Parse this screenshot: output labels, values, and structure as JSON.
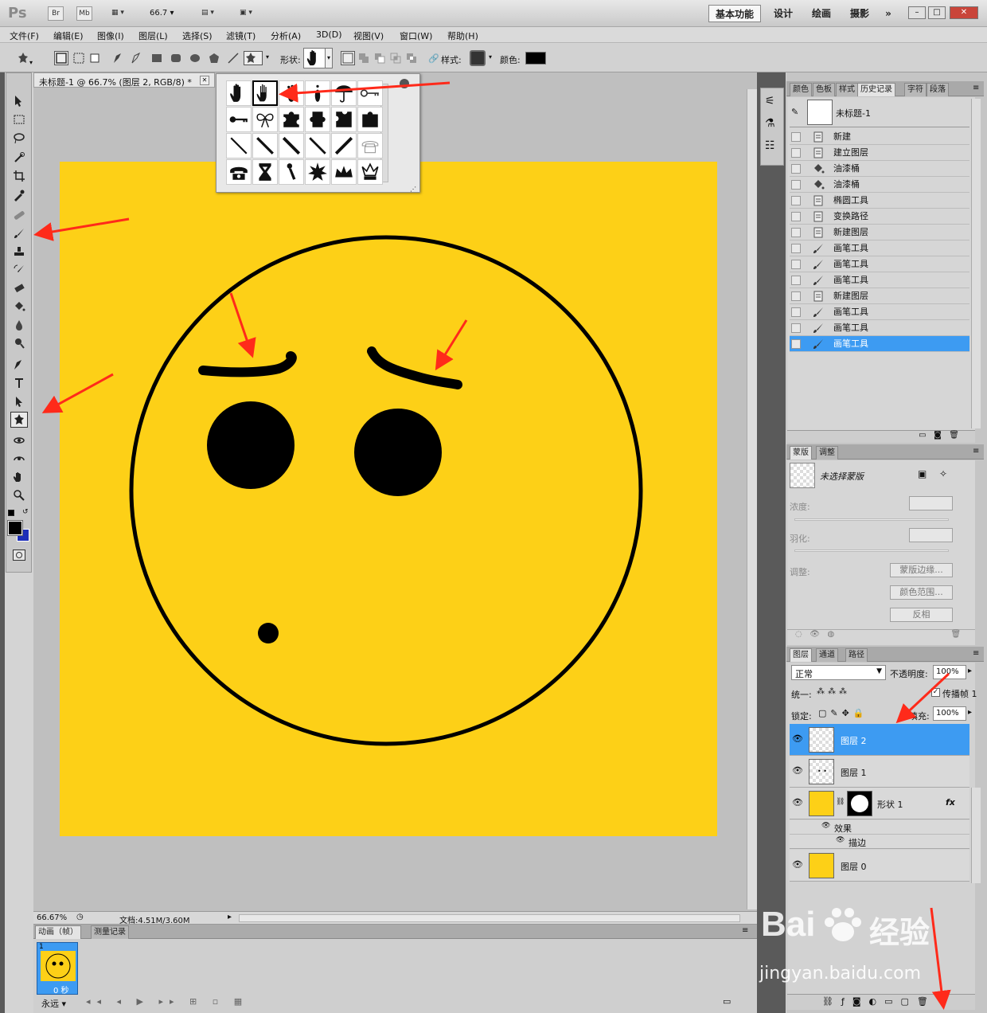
{
  "app": {
    "logo": "Ps",
    "br": "Br",
    "mb": "Mb",
    "zoom": "66.7"
  },
  "workspaces": [
    "基本功能",
    "设计",
    "绘画",
    "摄影",
    "»"
  ],
  "menu": [
    "文件(F)",
    "编辑(E)",
    "图像(I)",
    "图层(L)",
    "选择(S)",
    "滤镜(T)",
    "分析(A)",
    "3D(D)",
    "视图(V)",
    "窗口(W)",
    "帮助(H)"
  ],
  "options": {
    "shape_label": "形状:",
    "style_label": "样式:",
    "color_label": "颜色:"
  },
  "document": {
    "tab_title": "未标题-1 @ 66.7% (图层 2, RGB/8) *",
    "zoom_status": "66.67%",
    "doc_info": "文档:4.51M/3.60M",
    "canvas_color": "#fdd017"
  },
  "animation": {
    "tabs": [
      "动画（帧）",
      "测量记录"
    ],
    "frame_num": "1",
    "frame_time": "0 秒",
    "loop": "永远"
  },
  "history": {
    "tabs": [
      "颜色",
      "色板",
      "样式",
      "历史记录",
      "字符",
      "段落"
    ],
    "snapshot": "未标题-1",
    "items": [
      {
        "label": "新建",
        "icon": "doc-icon"
      },
      {
        "label": "建立图层",
        "icon": "doc-icon"
      },
      {
        "label": "油漆桶",
        "icon": "bucket-icon"
      },
      {
        "label": "油漆桶",
        "icon": "bucket-icon"
      },
      {
        "label": "椭圆工具",
        "icon": "doc-icon"
      },
      {
        "label": "变换路径",
        "icon": "doc-icon"
      },
      {
        "label": "新建图层",
        "icon": "doc-icon"
      },
      {
        "label": "画笔工具",
        "icon": "brush-icon"
      },
      {
        "label": "画笔工具",
        "icon": "brush-icon"
      },
      {
        "label": "画笔工具",
        "icon": "brush-icon"
      },
      {
        "label": "新建图层",
        "icon": "doc-icon"
      },
      {
        "label": "画笔工具",
        "icon": "brush-icon"
      },
      {
        "label": "画笔工具",
        "icon": "brush-icon"
      },
      {
        "label": "画笔工具",
        "icon": "brush-icon"
      }
    ]
  },
  "masks": {
    "tabs": [
      "蒙版",
      "调整"
    ],
    "no_mask": "未选择蒙版",
    "density": "浓度:",
    "feather": "羽化:",
    "adjust": "调整:",
    "btn_edge": "蒙版边缘...",
    "btn_range": "颜色范围...",
    "btn_invert": "反相"
  },
  "layers": {
    "tabs": [
      "图层",
      "通道",
      "路径"
    ],
    "blend": "正常",
    "opacity_label": "不透明度:",
    "opacity": "100%",
    "unify": "统一:",
    "propagate": "传播帧 1",
    "lock": "锁定:",
    "fill_label": "填充:",
    "fill": "100%",
    "items": [
      {
        "name": "图层 2"
      },
      {
        "name": "图层 1"
      },
      {
        "name": "形状 1",
        "fx": "fx"
      },
      {
        "name": "图层 0"
      }
    ],
    "effects": "效果",
    "stroke": "描边"
  },
  "watermark": {
    "brand": "Bai",
    "brand2": "经验",
    "url": "jingyan.baidu.com"
  },
  "colors": {
    "accent": "#3d9bf2",
    "arrow": "#ff2a1a",
    "yellow": "#fdd017"
  }
}
